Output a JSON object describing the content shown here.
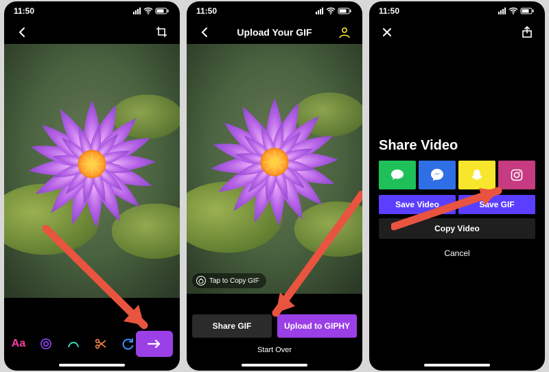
{
  "status": {
    "time": "11:50"
  },
  "screen1": {
    "tools": {
      "text_label": "Aa"
    }
  },
  "screen2": {
    "title": "Upload Your GIF",
    "tap_to_copy": "Tap to Copy GIF",
    "share_gif": "Share GIF",
    "upload_giphy": "Upload to GIPHY",
    "start_over": "Start Over"
  },
  "screen3": {
    "title": "Share Video",
    "save_video": "Save Video",
    "save_gif": "Save GIF",
    "copy_video": "Copy Video",
    "cancel": "Cancel",
    "share_targets": [
      {
        "name": "messages",
        "bg": "#1fc05a"
      },
      {
        "name": "messenger",
        "bg": "#2f6fe6"
      },
      {
        "name": "snapchat",
        "bg": "#f7e62c"
      },
      {
        "name": "instagram",
        "bg": "#c63b82"
      }
    ]
  },
  "colors": {
    "purple": "#9b3fe6",
    "indigo": "#5a3fff",
    "pink": "#ff3fa3",
    "teal": "#2fd6b8",
    "orange": "#ff8a3f",
    "blue": "#3f8fff"
  }
}
